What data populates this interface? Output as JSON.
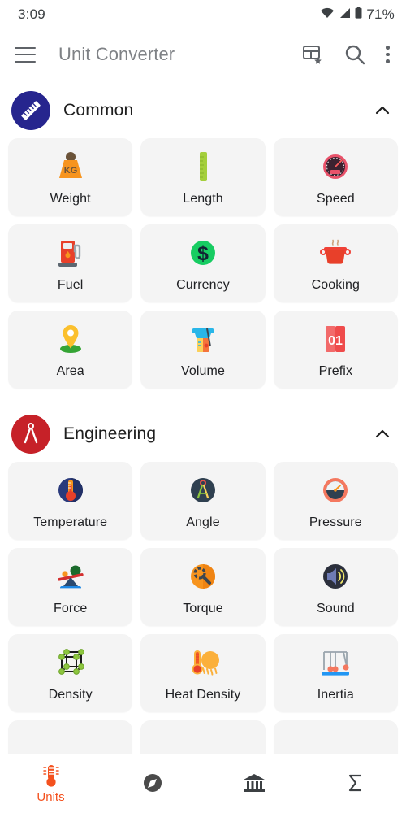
{
  "status_bar": {
    "time": "3:09",
    "battery_pct": "71%",
    "icons": [
      "wifi-icon",
      "signal-icon",
      "battery-icon"
    ]
  },
  "app_bar": {
    "menu_icon": "hamburger-menu-icon",
    "title": "Unit Converter",
    "actions": [
      {
        "name": "favorites-grid-icon",
        "label": "Custom units"
      },
      {
        "name": "search-icon",
        "label": "Search"
      },
      {
        "name": "overflow-menu-icon",
        "label": "More options"
      }
    ]
  },
  "sections": [
    {
      "id": "common",
      "title": "Common",
      "badge_icon": "ruler-icon",
      "badge_color": "#26258e",
      "expanded": true,
      "chevron": "chevron-up-icon",
      "items": [
        {
          "label": "Weight",
          "icon": "weight-kg-icon"
        },
        {
          "label": "Length",
          "icon": "ruler-green-icon"
        },
        {
          "label": "Speed",
          "icon": "speedometer-icon"
        },
        {
          "label": "Fuel",
          "icon": "fuel-pump-icon"
        },
        {
          "label": "Currency",
          "icon": "dollar-coin-icon"
        },
        {
          "label": "Cooking",
          "icon": "cooking-pot-icon"
        },
        {
          "label": "Area",
          "icon": "map-pin-icon"
        },
        {
          "label": "Volume",
          "icon": "beaker-icon"
        },
        {
          "label": "Prefix",
          "icon": "flip-card-01-icon"
        }
      ]
    },
    {
      "id": "engineering",
      "title": "Engineering",
      "badge_icon": "compass-divider-icon",
      "badge_color": "#c62128",
      "expanded": true,
      "chevron": "chevron-up-icon",
      "items": [
        {
          "label": "Temperature",
          "icon": "thermometer-blue-circle-icon"
        },
        {
          "label": "Angle",
          "icon": "divider-slate-circle-icon"
        },
        {
          "label": "Pressure",
          "icon": "pressure-gauge-icon"
        },
        {
          "label": "Force",
          "icon": "seesaw-balance-icon"
        },
        {
          "label": "Torque",
          "icon": "wrench-orange-circle-icon"
        },
        {
          "label": "Sound",
          "icon": "speaker-icon"
        },
        {
          "label": "Density",
          "icon": "cube-lattice-icon"
        },
        {
          "label": "Heat Density",
          "icon": "thermometer-sun-icon"
        },
        {
          "label": "Inertia",
          "icon": "newtons-cradle-icon"
        }
      ]
    }
  ],
  "bottom_nav": {
    "active_index": 0,
    "items": [
      {
        "label": "Units",
        "icon": "thermometer-units-icon",
        "active": true
      },
      {
        "label": "",
        "icon": "compass-circle-icon",
        "active": false
      },
      {
        "label": "",
        "icon": "bank-building-icon",
        "active": false
      },
      {
        "label": "",
        "icon": "sigma-icon",
        "active": false
      }
    ]
  },
  "colors": {
    "accent": "#f4511e",
    "card_bg": "#f4f4f4",
    "title_gray": "#7f8286",
    "text": "#202124"
  }
}
